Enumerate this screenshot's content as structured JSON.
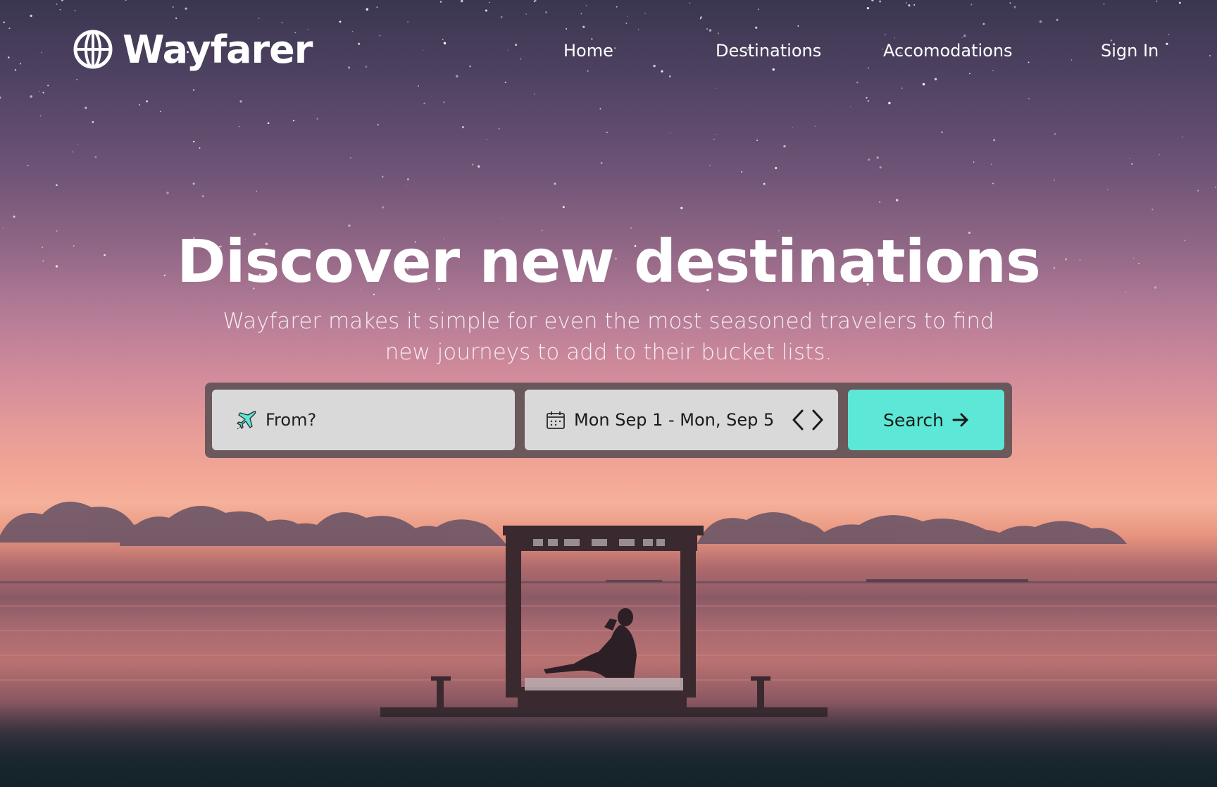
{
  "brand": {
    "name": "Wayfarer",
    "logo_icon": "globe-icon"
  },
  "nav": {
    "home": "Home",
    "destinations": "Destinations",
    "accommodations": "Accomodations",
    "sign_in": "Sign In"
  },
  "hero": {
    "headline": "Discover new destinations",
    "subcopy": "Wayfarer makes it simple for even the most seasoned travelers to find new journeys to add to their bucket lists."
  },
  "search": {
    "from_placeholder": "From?",
    "from_icon": "airplane-icon",
    "date_icon": "calendar-icon",
    "date_range": "Mon Sep 1 - Mon, Sep 5",
    "prev_icon": "chevron-left-icon",
    "next_icon": "chevron-right-icon",
    "button_label": "Search",
    "button_icon": "arrow-right-icon"
  },
  "colors": {
    "accent": "#5ce7d6",
    "field_bg": "#d9d9d9",
    "text_light": "#ffffff"
  }
}
